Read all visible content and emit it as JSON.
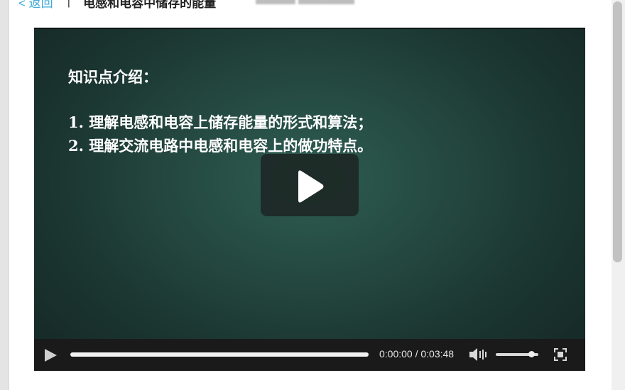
{
  "header": {
    "back_label": "< 返回",
    "separator": "|",
    "title": "电感和电容中储存的能量"
  },
  "slide": {
    "heading": "知识点介绍：",
    "lines": [
      "1. 理解电感和电容上储存能量的形式和算法；",
      "2. 理解交流电路中电感和电容上的做功特点。"
    ]
  },
  "player": {
    "time_display": "0:00:00 / 0:03:48",
    "progress": 0,
    "volume": 0.85
  },
  "colors": {
    "link": "#3fa9d6",
    "video_bg": "#23463e",
    "controls_bg": "#1a1a1a"
  },
  "icons": [
    "play-icon",
    "volume-icon",
    "fullscreen-icon"
  ]
}
